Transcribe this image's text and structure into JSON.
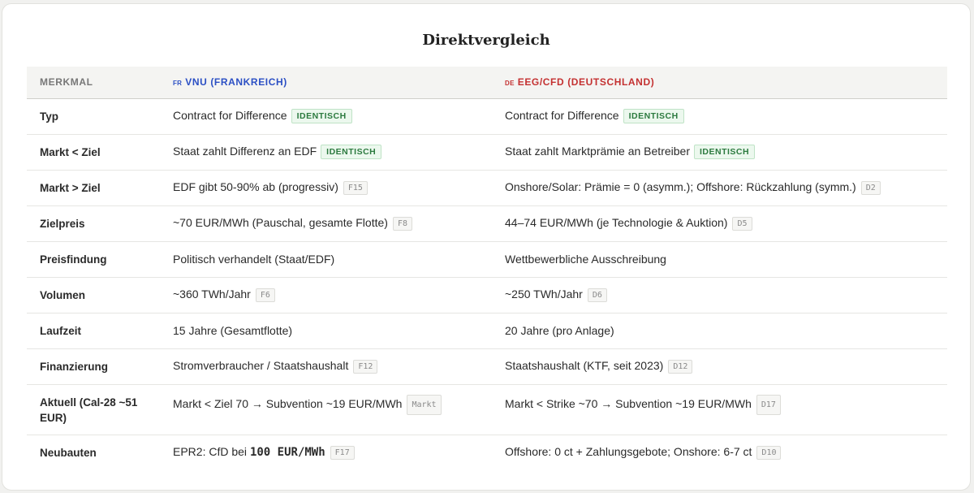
{
  "title": "Direktvergleich",
  "header": {
    "col1": "MERKMAL",
    "col2_flag": "FR",
    "col2": "VNU (FRANKREICH)",
    "col3_flag": "DE",
    "col3": "EEG/CFD (DEUTSCHLAND)"
  },
  "rows": [
    {
      "label": "Typ",
      "fr": {
        "text": "Contract for Difference",
        "badge": "IDENTISCH"
      },
      "de": {
        "text": "Contract for Difference",
        "badge": "IDENTISCH"
      }
    },
    {
      "label": "Markt < Ziel",
      "fr": {
        "text": "Staat zahlt Differenz an EDF",
        "badge": "IDENTISCH"
      },
      "de": {
        "text": "Staat zahlt Marktprämie an Betreiber",
        "badge": "IDENTISCH"
      }
    },
    {
      "label": "Markt > Ziel",
      "fr": {
        "text": "EDF gibt 50-90% ab (progressiv)",
        "ref": "F15"
      },
      "de": {
        "text": "Onshore/Solar: Prämie = 0 (asymm.); Offshore: Rückzahlung (symm.)",
        "ref": "D2"
      }
    },
    {
      "label": "Zielpreis",
      "fr": {
        "text": "~70 EUR/MWh (Pauschal, gesamte Flotte)",
        "ref": "F8"
      },
      "de": {
        "text": "44–74 EUR/MWh (je Technologie & Auktion)",
        "ref": "D5"
      }
    },
    {
      "label": "Preisfindung",
      "fr": {
        "text": "Politisch verhandelt (Staat/EDF)"
      },
      "de": {
        "text": "Wettbewerbliche Ausschreibung"
      }
    },
    {
      "label": "Volumen",
      "fr": {
        "text": "~360 TWh/Jahr",
        "ref": "F6"
      },
      "de": {
        "text": "~250 TWh/Jahr",
        "ref": "D6"
      }
    },
    {
      "label": "Laufzeit",
      "fr": {
        "text": "15 Jahre (Gesamtflotte)"
      },
      "de": {
        "text": "20 Jahre (pro Anlage)"
      }
    },
    {
      "label": "Finanzierung",
      "fr": {
        "text": "Stromverbraucher / Staatshaushalt",
        "ref": "F12"
      },
      "de": {
        "text": "Staatshaushalt (KTF, seit 2023)",
        "ref": "D12"
      }
    },
    {
      "label": "Aktuell (Cal-28 ~51 EUR)",
      "fr": {
        "text": "Markt < Ziel 70 → Subvention ~19 EUR/MWh",
        "ref": "Markt"
      },
      "de": {
        "text": "Markt < Strike ~70 → Subvention ~19 EUR/MWh",
        "ref": "D17"
      }
    },
    {
      "label": "Neubauten",
      "fr": {
        "text_pre": "EPR2: CfD bei",
        "text_strong": "100 EUR/MWh",
        "ref": "F17"
      },
      "de": {
        "text": "Offshore: 0 ct + Zahlungsgebote; Onshore: 6-7 ct",
        "ref": "D10"
      }
    }
  ]
}
